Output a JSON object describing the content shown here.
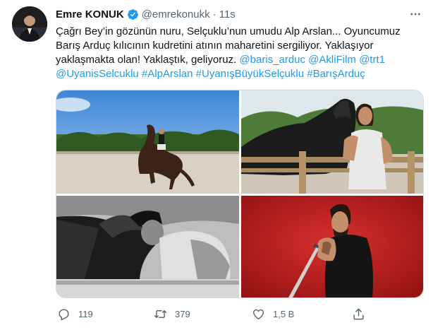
{
  "author": {
    "name": "Emre KONUK",
    "handle": "@emrekonukk",
    "separator": "·",
    "time": "11s"
  },
  "text": {
    "line1": "Çağrı Bey’in gözünün nuru, Selçuklu’nun umudu Alp Arslan... Oyuncumuz",
    "line2": "Barış Arduç kılıcının kudretini atının maharetini sergiliyor. Yaklaşıyor",
    "line3_plain": "yaklaşmakta olan! Yaklaştık, geliyoruz. ",
    "line3_mentions": "@baris_arduc @AkliFilm @trt1",
    "line4_tags": "@UyanisSelcuklu #AlpArslan #UyanışBüyükSelçuklu #BarışArduç"
  },
  "actions": {
    "reply_count": "119",
    "retweet_count": "379",
    "like_count": "1,5 B",
    "share_label": ""
  },
  "colors": {
    "link": "#1d9bf0",
    "verified": "#1d9bf0",
    "secondary_text": "#536471"
  },
  "icons": [
    "more-icon",
    "verified-badge-icon",
    "reply-icon",
    "retweet-icon",
    "like-icon",
    "share-icon"
  ]
}
